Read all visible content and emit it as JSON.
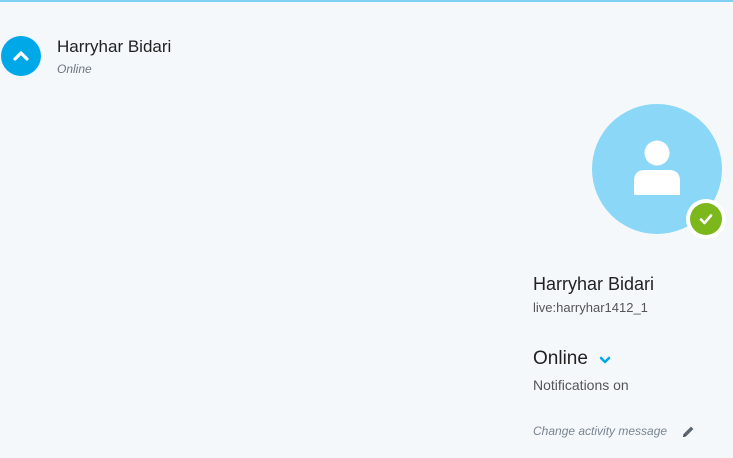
{
  "header": {
    "contact_name": "Harryhar Bidari",
    "status_text": "Online"
  },
  "profile": {
    "display_name": "Harryhar Bidari",
    "skype_id": "live:harryhar1412_1",
    "status_label": "Online",
    "notifications_text": "Notifications on",
    "activity_message_placeholder": "Change activity message"
  },
  "icons": {
    "collapse": "chevron-up-icon",
    "avatar": "person-icon",
    "presence": "checkmark-icon",
    "status_dropdown": "chevron-down-icon",
    "edit": "pencil-icon"
  },
  "colors": {
    "accent": "#00a8e8",
    "avatar_bg": "#8ad7f7",
    "presence_online": "#7cb81c",
    "background": "#f4f8fb"
  }
}
